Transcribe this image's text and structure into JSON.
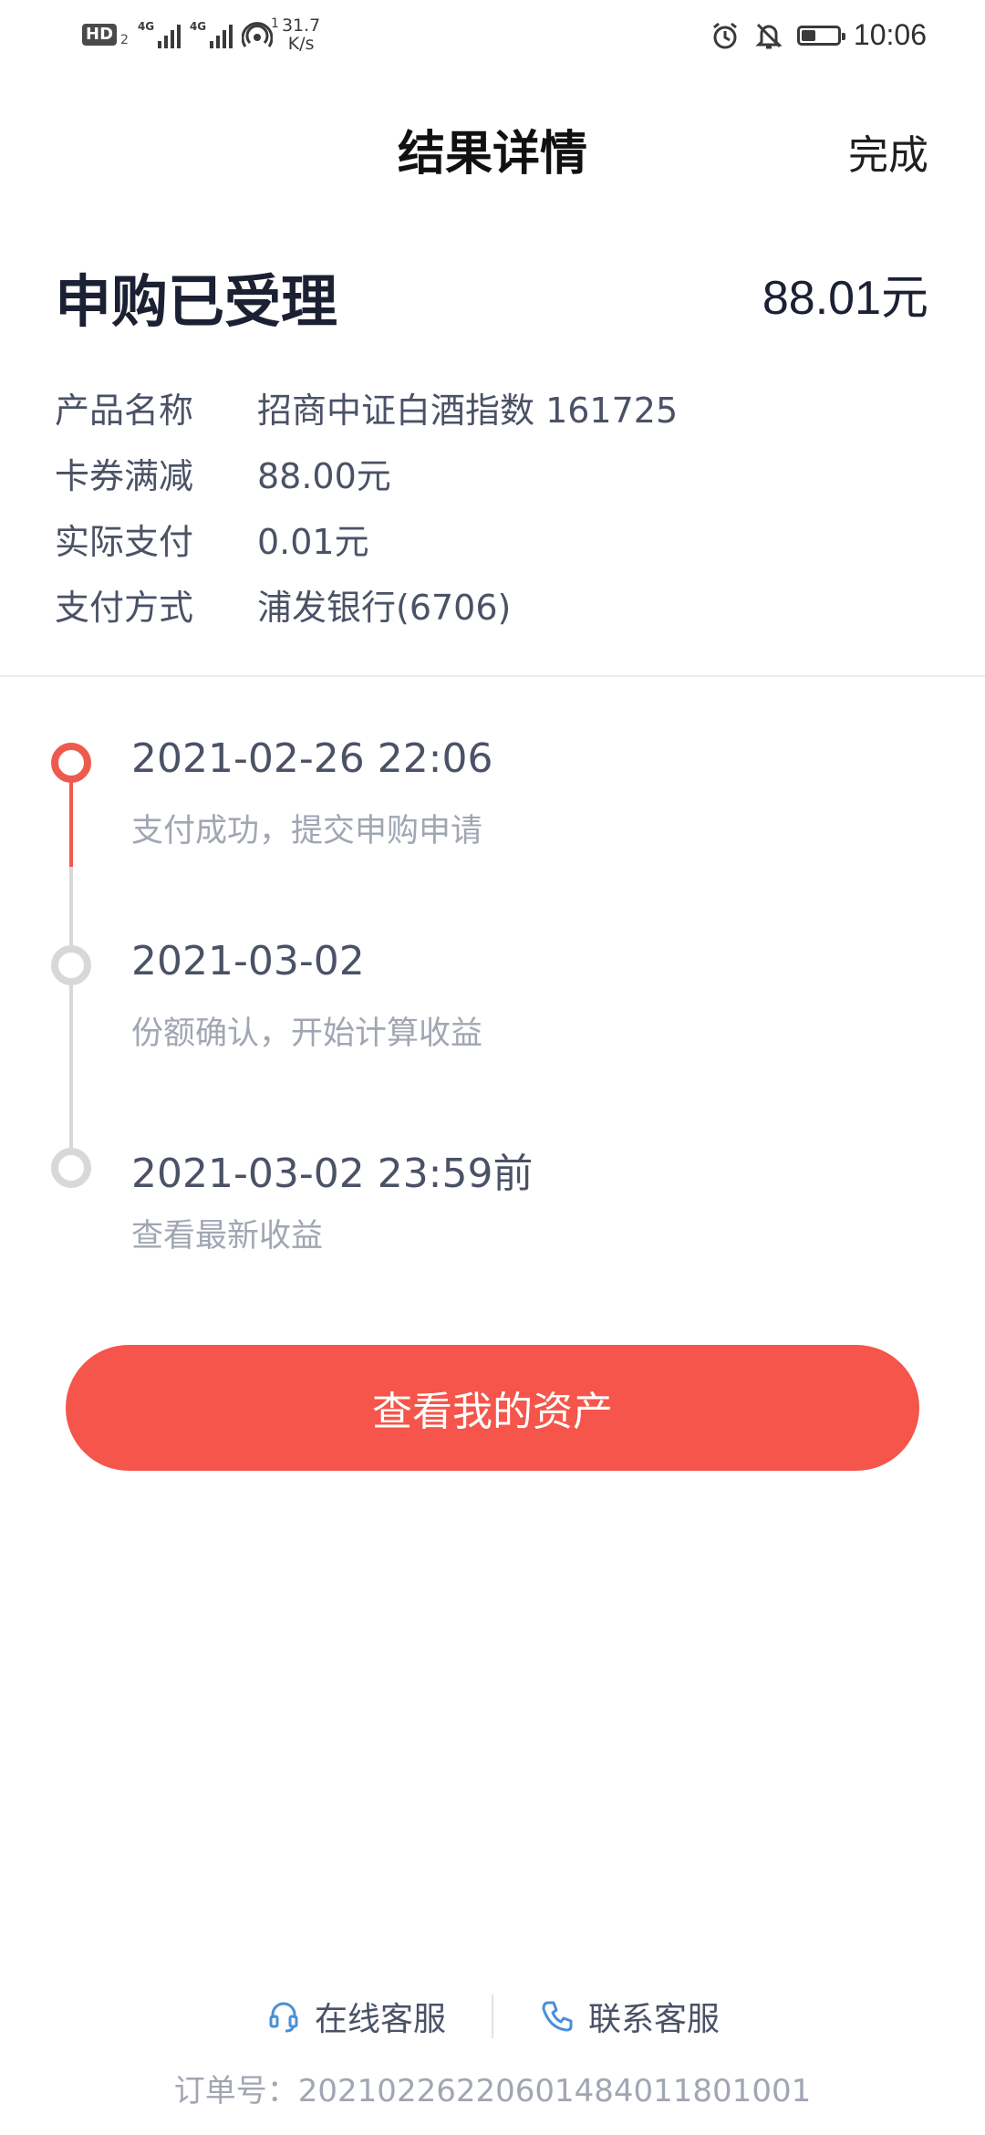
{
  "status_bar": {
    "hd_label": "HD",
    "hd_sub": "2",
    "network_1": "4G",
    "network_2": "4G",
    "speed_sup": "1",
    "speed_value": "31.7",
    "speed_unit": "K/s",
    "battery_level": 0.4,
    "time": "10:06",
    "icons": [
      "signal-icon",
      "wifi-hotspot-icon",
      "alarm-icon",
      "mute-icon",
      "battery-icon"
    ]
  },
  "header": {
    "title": "结果详情",
    "done_label": "完成"
  },
  "summary": {
    "status": "申购已受理",
    "amount": "88.01元",
    "details": [
      {
        "label": "产品名称",
        "value": "招商中证白酒指数 161725"
      },
      {
        "label": "卡券满减",
        "value": "88.00元"
      },
      {
        "label": "实际支付",
        "value": "0.01元"
      },
      {
        "label": "支付方式",
        "value": "浦发银行(6706)"
      }
    ]
  },
  "timeline": {
    "steps": [
      {
        "time": "2021-02-26 22:06",
        "desc": "支付成功，提交申购申请",
        "state": "done"
      },
      {
        "time": "2021-03-02",
        "desc": "份额确认，开始计算收益",
        "state": "pending"
      },
      {
        "time": "2021-03-02 23:59前",
        "desc": "查看最新收益",
        "state": "pending"
      }
    ]
  },
  "primary_button": {
    "label": "查看我的资产"
  },
  "footer": {
    "online_service": "在线客服",
    "contact_service": "联系客服",
    "order_label": "订单号：",
    "order_number": "20210226220601484011801001"
  },
  "colors": {
    "accent": "#f5554a",
    "timeline_active": "#ef5a4f",
    "timeline_inactive": "#d8d8d8",
    "text_primary": "#1b2033",
    "text_secondary": "#4b5266",
    "text_muted": "#a1a6b3",
    "service_icon": "#4a8fd8"
  }
}
